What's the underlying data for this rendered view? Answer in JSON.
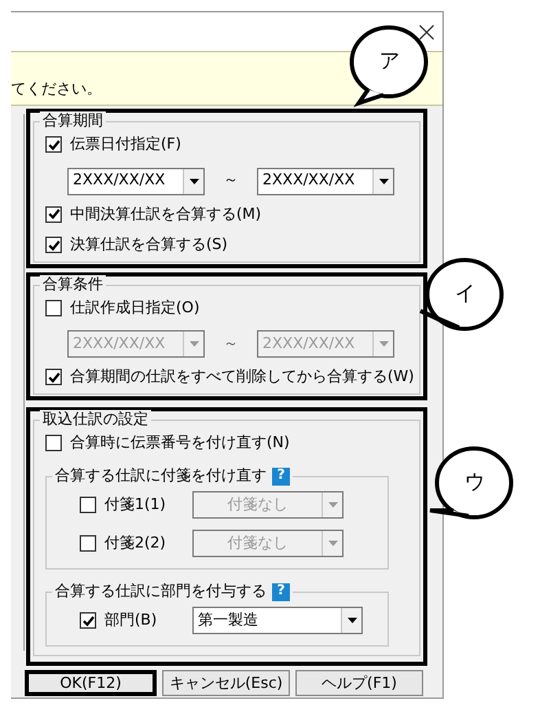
{
  "notice": "てください。",
  "period": {
    "legend": "合算期間",
    "slip_date": {
      "label": "伝票日付指定(F)",
      "checked": true
    },
    "dates": [
      {
        "value": "2XXX/XX/XX",
        "disabled": false
      },
      {
        "value": "2XXX/XX/XX",
        "disabled": false
      }
    ],
    "range_mark": "～",
    "options": [
      {
        "label": "中間決算仕訳を合算する(M)",
        "checked": true
      },
      {
        "label": "決算仕訳を合算する(S)",
        "checked": true
      }
    ]
  },
  "condition": {
    "legend": "合算条件",
    "created_date": {
      "label": "仕訳作成日指定(O)",
      "checked": false
    },
    "dates": [
      {
        "value": "2XXX/XX/XX",
        "disabled": true
      },
      {
        "value": "2XXX/XX/XX",
        "disabled": true
      }
    ],
    "range_mark": "～",
    "delete_first": {
      "label": "合算期間の仕訳をすべて削除してから合算する(W)",
      "checked": true
    }
  },
  "import": {
    "legend": "取込仕訳の設定",
    "renumber": {
      "label": "合算時に伝票番号を付け直す(N)",
      "checked": false
    },
    "subgroups": [
      {
        "legend": "合算する仕訳に付箋を付け直す",
        "help": "?",
        "rows": [
          {
            "label": "付箋1(1)",
            "checked": false,
            "value": "付箋なし",
            "disabled": true
          },
          {
            "label": "付箋2(2)",
            "checked": false,
            "value": "付箋なし",
            "disabled": true
          }
        ]
      },
      {
        "legend": "合算する仕訳に部門を付与する",
        "help": "?",
        "rows": [
          {
            "label": "部門(B)",
            "checked": true,
            "value": "第一製造",
            "disabled": false
          }
        ]
      }
    ]
  },
  "buttons": [
    {
      "label": "OK(F12)",
      "highlighted": true
    },
    {
      "label": "キャンセル(Esc)",
      "highlighted": false
    },
    {
      "label": "ヘルプ(F1)",
      "highlighted": false
    }
  ],
  "annotations": [
    {
      "label": "ア"
    },
    {
      "label": "イ"
    },
    {
      "label": "ウ"
    }
  ]
}
